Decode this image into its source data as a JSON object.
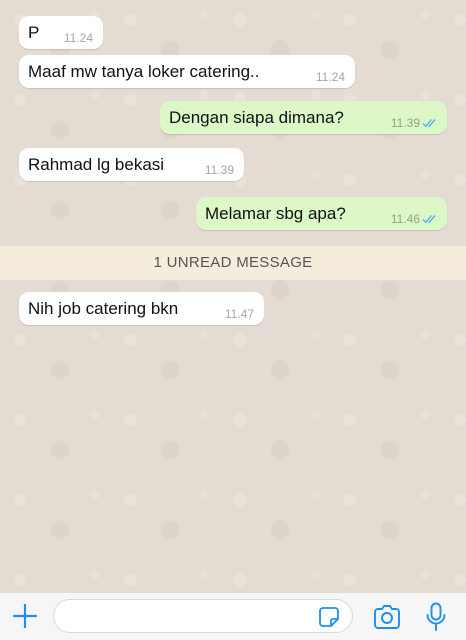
{
  "messages": [
    {
      "direction": "in",
      "text": "P",
      "time": "11.24"
    },
    {
      "direction": "in",
      "text": "Maaf mw tanya loker catering..",
      "time": "11.24"
    },
    {
      "direction": "out",
      "text": "Dengan siapa dimana?",
      "time": "11.39",
      "status": "read"
    },
    {
      "direction": "in",
      "text": "Rahmad lg bekasi",
      "time": "11.39"
    },
    {
      "direction": "out",
      "text": "Melamar sbg apa?",
      "time": "11.46",
      "status": "read"
    },
    {
      "direction": "in",
      "text": "Nih job catering bkn",
      "time": "11.47"
    }
  ],
  "unread_banner": "1 UNREAD MESSAGE",
  "composer": {
    "placeholder": "",
    "icons": [
      "plus-icon",
      "sticker-icon",
      "camera-icon",
      "microphone-icon"
    ]
  },
  "colors": {
    "incoming_bubble": "#ffffff",
    "outgoing_bubble": "#dcf8c6",
    "read_ticks": "#4fb6ec",
    "accent": "#1f8ef1"
  }
}
